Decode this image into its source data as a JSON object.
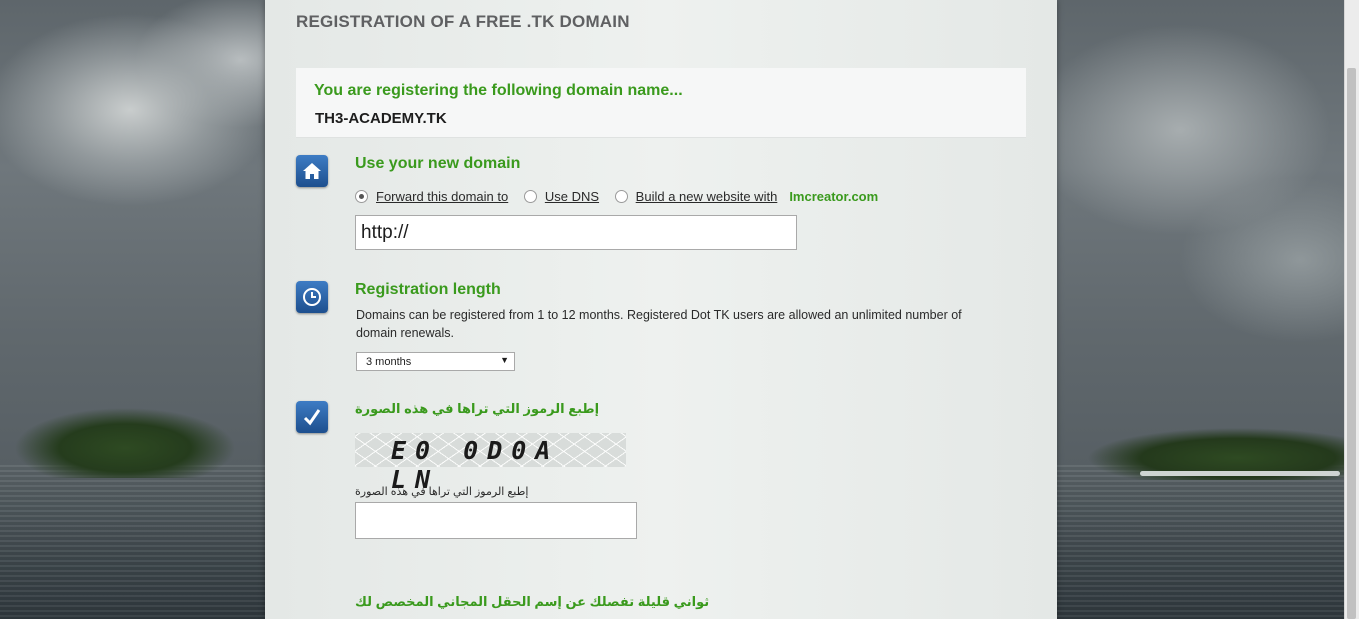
{
  "page": {
    "title": "REGISTRATION OF A FREE .TK DOMAIN"
  },
  "domain_box": {
    "message": "You are registering the following domain name...",
    "domain_name": "TH3-ACADEMY.TK"
  },
  "use_domain": {
    "title": "Use your new domain",
    "options": [
      {
        "label": "Forward this domain to",
        "checked": true
      },
      {
        "label": "Use DNS",
        "checked": false
      },
      {
        "label": "Build a new website with",
        "checked": false
      }
    ],
    "brand_link": "Imcreator.com",
    "url_value": "http://"
  },
  "registration_length": {
    "title": "Registration length",
    "description": "Domains can be registered from 1 to 12 months. Registered Dot TK users are allowed an unlimited number of domain renewals.",
    "selected": "3 months"
  },
  "captcha": {
    "heading": "إطبع الرموز التي تراها في هذه الصورة",
    "image_text": "E0 0D0A LN",
    "field_label": "إطبع الرموز التي تراها في هذه الصورة",
    "input_value": ""
  },
  "footer": {
    "message": "ثواني قليلة تفصلك عن إسم الحقل المجاني المخصص لك"
  },
  "colors": {
    "accent_green": "#3a9a1d",
    "icon_blue": "#2a62a8",
    "panel_bg": "#eaedeb"
  },
  "icons": [
    "home-icon",
    "clock-icon",
    "checkmark-icon"
  ]
}
